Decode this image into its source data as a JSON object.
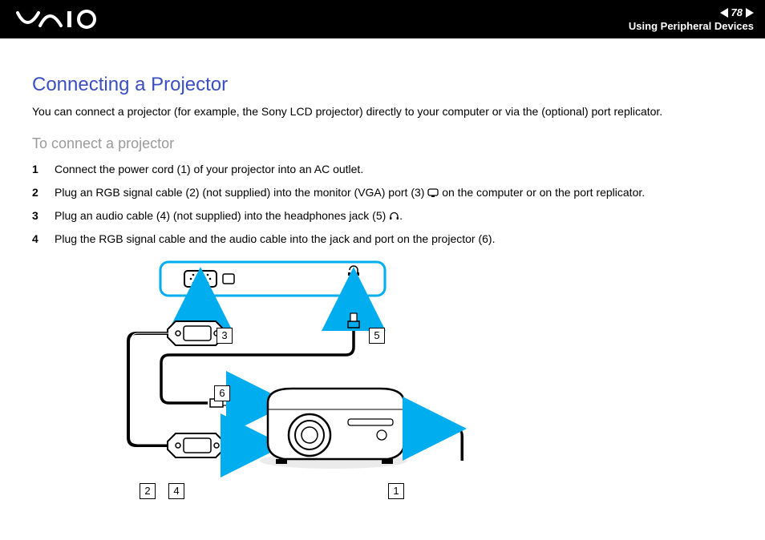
{
  "header": {
    "page_number": "78",
    "section_title": "Using Peripheral Devices"
  },
  "page": {
    "title": "Connecting a Projector",
    "intro": "You can connect a projector (for example, the Sony LCD projector) directly to your computer or via the (optional) port replicator.",
    "subhead": "To connect a projector",
    "steps": [
      {
        "pre": "Connect the power cord (1) of your projector into an AC outlet.",
        "icon": null,
        "post": ""
      },
      {
        "pre": "Plug an RGB signal cable (2) (not supplied) into the monitor (VGA) port (3) ",
        "icon": "monitor-port-icon",
        "post": " on the computer or on the port replicator."
      },
      {
        "pre": "Plug an audio cable (4) (not supplied) into the headphones jack (5) ",
        "icon": "headphone-icon",
        "post": "."
      },
      {
        "pre": "Plug the RGB signal cable and the audio cable into the jack and port on the projector (6).",
        "icon": null,
        "post": ""
      }
    ]
  },
  "diagram": {
    "labels": {
      "l1": "1",
      "l2": "2",
      "l3": "3",
      "l4": "4",
      "l5": "5",
      "l6": "6"
    }
  }
}
